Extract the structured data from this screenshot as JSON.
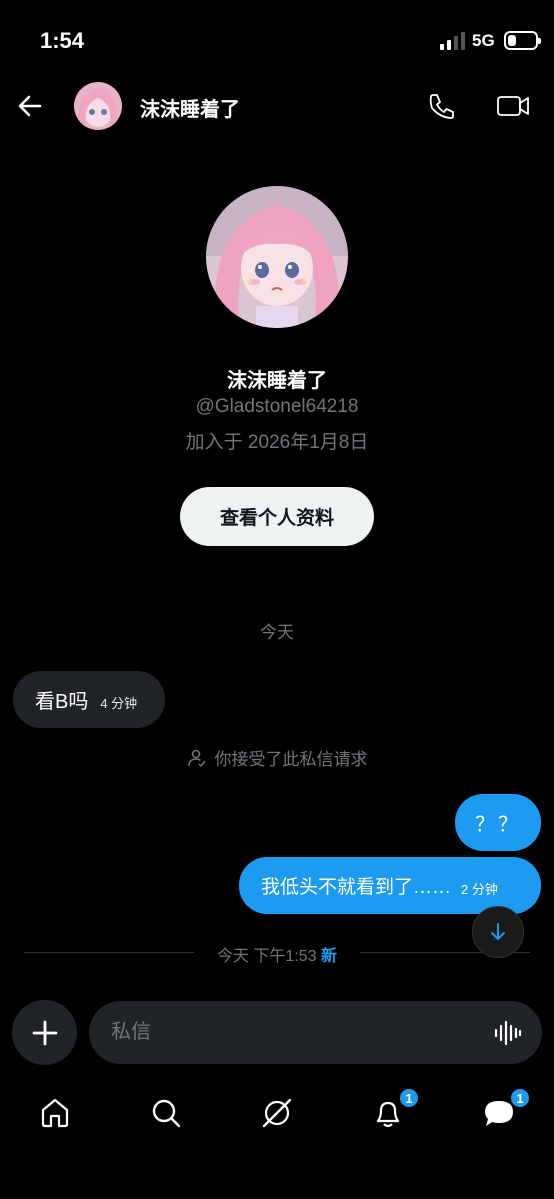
{
  "status_bar": {
    "time": "1:54",
    "network": "5G",
    "battery_level": 0.3
  },
  "header": {
    "contact_name": "沫沫睡着了",
    "icons": [
      "back-arrow-icon",
      "phone-icon",
      "video-icon"
    ]
  },
  "profile": {
    "name": "沫沫睡着了",
    "handle": "@Gladstonel64218",
    "joined": "加入于 2026年1月8日",
    "view_profile_label": "查看个人资料"
  },
  "conversation": {
    "day_label": "今天",
    "messages": [
      {
        "direction": "in",
        "text": "看B吗",
        "time": "4 分钟"
      },
      {
        "direction": "out",
        "text": "？？",
        "time": ""
      },
      {
        "direction": "out",
        "text": "我低头不就看到了……",
        "time": "2 分钟"
      }
    ],
    "accept_note": "你接受了此私信请求",
    "new_divider": {
      "date": "今天 下午1:53",
      "new_label": "新"
    }
  },
  "composer": {
    "placeholder": "私信"
  },
  "bottom_nav": {
    "items": [
      {
        "name": "home",
        "badge": ""
      },
      {
        "name": "search",
        "badge": ""
      },
      {
        "name": "grok",
        "badge": ""
      },
      {
        "name": "notifications",
        "badge": "1"
      },
      {
        "name": "messages",
        "badge": "1"
      }
    ]
  },
  "colors": {
    "accent": "#1d9bf0",
    "background": "#000000",
    "bubble_in": "#202327",
    "muted": "#71767b"
  }
}
